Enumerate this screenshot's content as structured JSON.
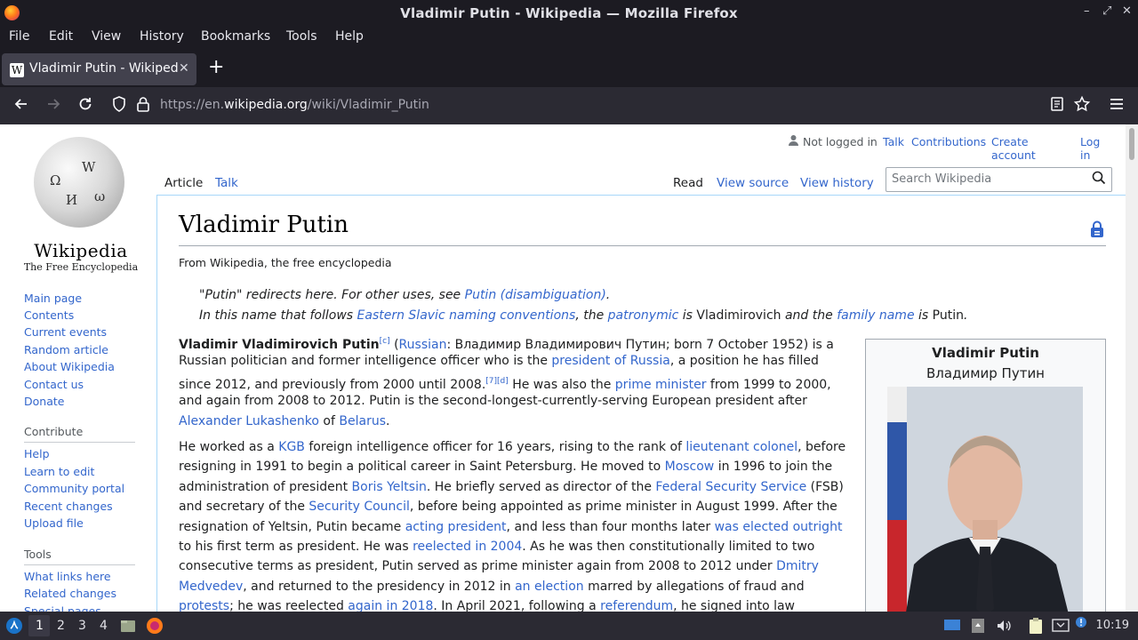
{
  "window": {
    "title": "Vladimir Putin - Wikipedia — Mozilla Firefox",
    "minimize": "–",
    "maximize": "⤢",
    "close": "✕"
  },
  "menu": [
    "File",
    "Edit",
    "View",
    "History",
    "Bookmarks",
    "Tools",
    "Help"
  ],
  "tab": {
    "label": "Vladimir Putin - Wikipedia",
    "favicon": "W",
    "close": "✕",
    "new_tab": "+"
  },
  "nav": {
    "url_prefix": "https://en.",
    "url_host": "wikipedia.org",
    "url_path": "/wiki/Vladimir_Putin"
  },
  "logo": {
    "wordmark": "Wikipedia",
    "tagline": "The Free Encyclopedia"
  },
  "sidebar": {
    "main": [
      "Main page",
      "Contents",
      "Current events",
      "Random article",
      "About Wikipedia",
      "Contact us",
      "Donate"
    ],
    "contribute_heading": "Contribute",
    "contribute": [
      "Help",
      "Learn to edit",
      "Community portal",
      "Recent changes",
      "Upload file"
    ],
    "tools_heading": "Tools",
    "tools": [
      "What links here",
      "Related changes",
      "Special pages"
    ]
  },
  "user": {
    "not_logged_in": "Not logged in",
    "talk": "Talk",
    "contributions": "Contributions",
    "create_account": "Create account",
    "log_in": "Log in"
  },
  "page_tabs": {
    "article": "Article",
    "talk": "Talk",
    "read": "Read",
    "view_source": "View source",
    "view_history": "View history"
  },
  "search": {
    "placeholder": "Search Wikipedia"
  },
  "article": {
    "title": "Vladimir Putin",
    "tagline": "From Wikipedia, the free encyclopedia",
    "hatnote1": {
      "pre": "\"Putin\" redirects here. For other uses, see ",
      "link": "Putin (disambiguation)",
      "post": "."
    },
    "hatnote2": {
      "p1": "In this name that follows ",
      "l1": "Eastern Slavic naming conventions",
      "p2": ", the ",
      "l2": "patronymic",
      "p3": " is ",
      "v1": "Vladimirovich",
      "p4": " and the ",
      "l3": "family name",
      "p5": " is ",
      "v2": "Putin",
      "p6": "."
    },
    "p1": {
      "l1_bold": "Vladimir Vladimirovich Putin",
      "l1_sup": "[c]",
      "l1_a": " (",
      "l1_link": "Russian",
      "l1_b": ": Владимир Владимирович Путин; born 7 October 1952) is a",
      "l2_a": "Russian politician and former intelligence officer who is the ",
      "l2_link": "president of Russia",
      "l2_b": ", a position he has filled",
      "l3_a": "since 2012, and previously from 2000 until 2008.",
      "l3_sup": "[7][d]",
      "l3_b": " He was also the ",
      "l3_link": "prime minister",
      "l3_c": " from 1999 to 2000,",
      "l4": "and again from 2008 to 2012. Putin is the second-longest-currently-serving European president after",
      "l5_link1": "Alexander Lukashenko",
      "l5_a": " of ",
      "l5_link2": "Belarus",
      "l5_b": "."
    },
    "p2": {
      "l1_a": "He worked as a ",
      "l1_link1": "KGB",
      "l1_b": " foreign intelligence officer for 16 years, rising to the rank of ",
      "l1_link2": "lieutenant colonel",
      "l1_c": ", before",
      "l2_a": "resigning in 1991 to begin a political career in Saint Petersburg. He moved to ",
      "l2_link": "Moscow",
      "l2_b": " in 1996 to join the",
      "l3_a": "administration of president ",
      "l3_link1": "Boris Yeltsin",
      "l3_b": ". He briefly served as director of the ",
      "l3_link2": "Federal Security Service",
      "l3_c": " (FSB)",
      "l4_a": "and secretary of the ",
      "l4_link": "Security Council",
      "l4_b": ", before being appointed as prime minister in August 1999. After the",
      "l5_a": "resignation of Yeltsin, Putin became ",
      "l5_link1": "acting president",
      "l5_b": ", and less than four months later ",
      "l5_link2": "was elected outright",
      "l6_a": "to his first term as president. He was ",
      "l6_link": "reelected in 2004",
      "l6_b": ". As he was then constitutionally limited to two",
      "l7_a": "consecutive terms as president, Putin served as prime minister again from 2008 to 2012 under ",
      "l7_link": "Dmitry",
      "l8_link1": "Medvedev",
      "l8_a": ", and returned to the presidency in 2012 in ",
      "l8_link2": "an election",
      "l8_b": " marred by allegations of fraud and",
      "l9_link1": "protests",
      "l9_a": "; he was reelected ",
      "l9_link2": "again in 2018",
      "l9_b": ". In April 2021, following a ",
      "l9_link3": "referendum",
      "l9_c": ", he signed into law"
    }
  },
  "infobox": {
    "name": "Vladimir Putin",
    "native_name": "Владимир Путин"
  },
  "taskbar": {
    "workspaces": [
      "1",
      "2",
      "3",
      "4"
    ],
    "clock": "10:19"
  }
}
